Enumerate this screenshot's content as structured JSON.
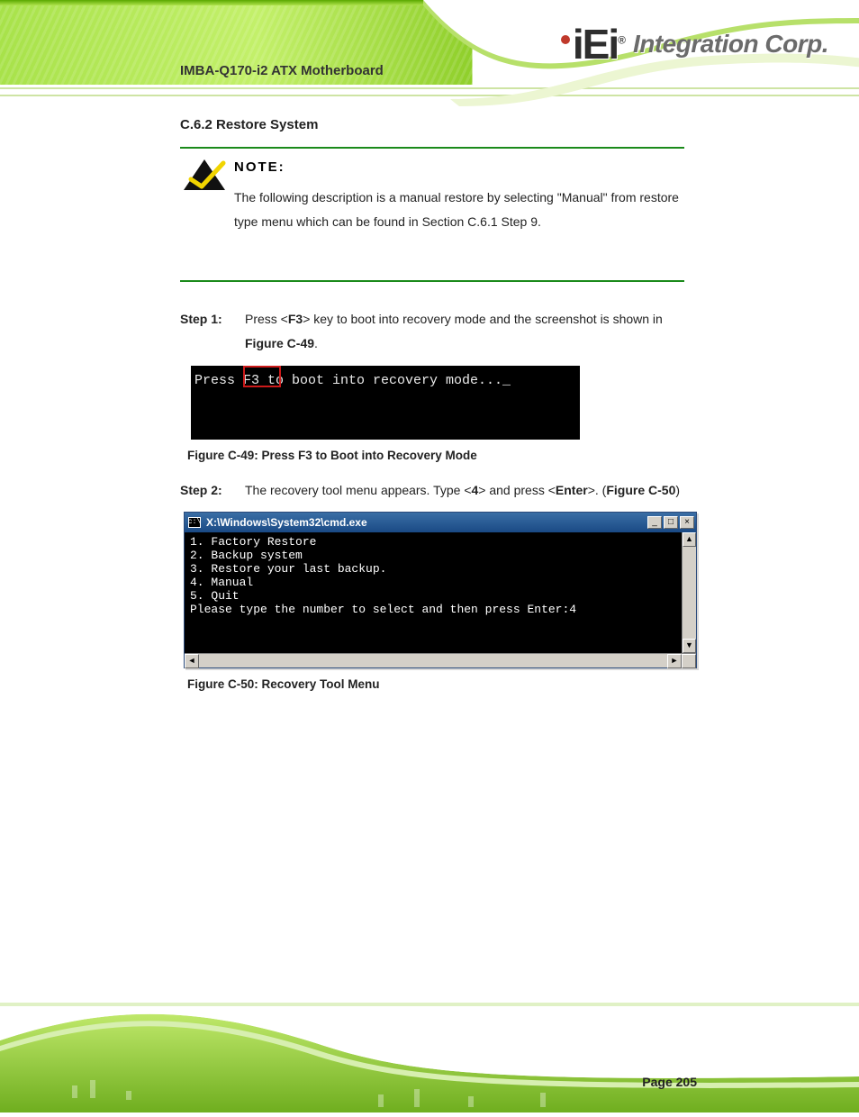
{
  "header": {
    "product": "IMBA-Q170-i2 ATX Motherboard",
    "logo_text": "iEi",
    "logo_reg": "®",
    "logo_corp": "Integration Corp."
  },
  "section_heading": "C.6.2 Restore System",
  "note": {
    "title": "NOTE:",
    "body": "The following description is a manual restore by selecting \"Manual\" from restore type menu which can be found in Section C.6.1 Step 9."
  },
  "steps": [
    {
      "label": "Step 1:",
      "text_before": "Press <",
      "key": "F3",
      "text_mid": "> key to boot into recovery mode and the screenshot is shown in ",
      "fig_ref": "Figure C-49"
    },
    {
      "label": "Step 2:",
      "text_before": "The recovery tool menu appears. Type <",
      "key": "4",
      "text_mid1": "> and press <",
      "key2": "Enter",
      "text_mid2": ">. (",
      "fig_ref": "Figure C-50",
      "text_after": ")"
    }
  ],
  "figure1": {
    "console_line": "Press F3 to boot into recovery mode..._",
    "caption": "Figure C-49: Press F3 to Boot into Recovery Mode"
  },
  "figure2": {
    "title_path": "X:\\Windows\\System32\\cmd.exe",
    "lines": [
      "1. Factory Restore",
      "2. Backup system",
      "3. Restore your last backup.",
      "4. Manual",
      "5. Quit",
      "Please type the number to select and then press Enter:4"
    ],
    "caption": "Figure C-50: Recovery Tool Menu"
  },
  "page": {
    "label": "Page 205"
  }
}
